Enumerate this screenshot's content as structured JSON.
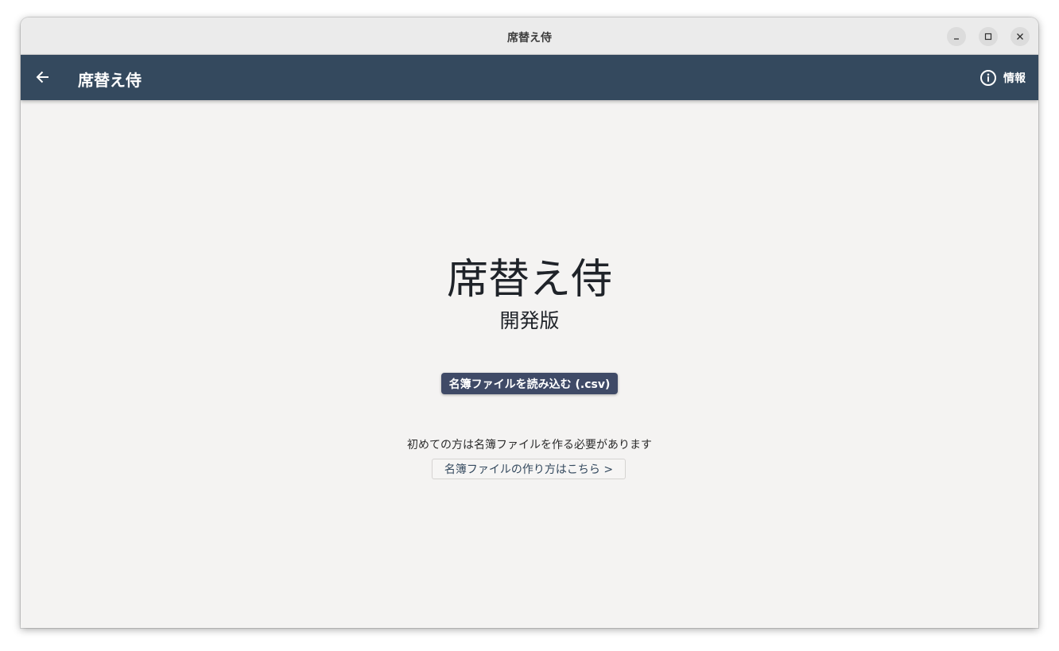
{
  "window": {
    "title": "席替え侍"
  },
  "appbar": {
    "title": "席替え侍",
    "info_label": "情報"
  },
  "main": {
    "title": "席替え侍",
    "subtitle": "開発版",
    "load_button": "名簿ファイルを読み込む (.csv)",
    "hint": "初めての方は名簿ファイルを作る必要があります",
    "howto_button": "名簿ファイルの作り方はこちら >"
  },
  "colors": {
    "appbar_bg": "#34495e",
    "primary_button": "#3f4a67",
    "content_bg": "#f4f3f2",
    "titlebar_bg": "#ebebeb"
  },
  "icons": {
    "back": "arrow-left-icon",
    "info": "info-circle-icon",
    "minimize": "minimize-icon",
    "maximize": "maximize-icon",
    "close": "close-icon"
  }
}
